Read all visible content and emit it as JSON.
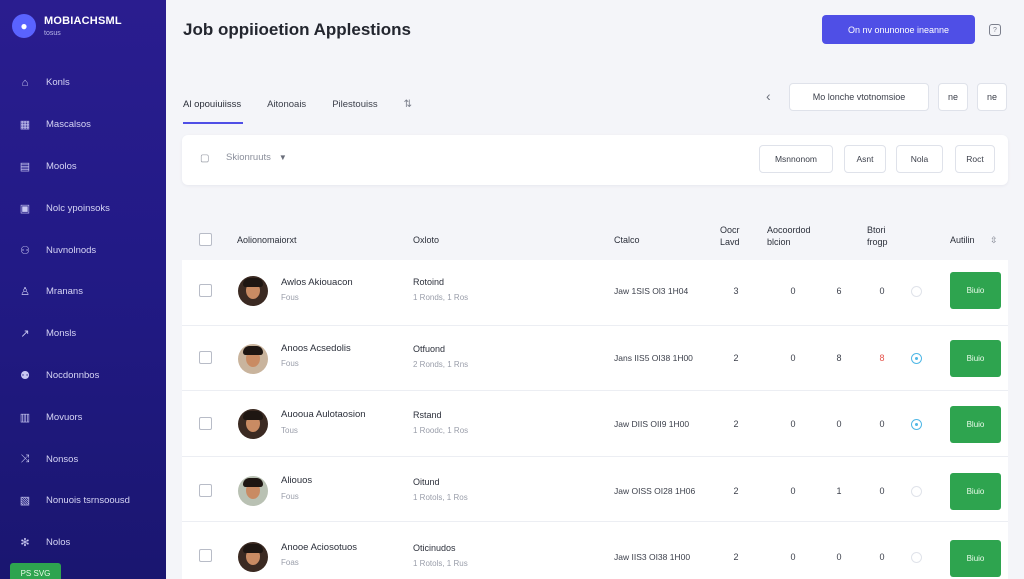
{
  "brand": {
    "title": "MOBIACHSML",
    "subtitle": "tosus",
    "logo_icon": "robot-icon"
  },
  "sidebar": {
    "items": [
      {
        "label": "Konls",
        "icon": "home-icon"
      },
      {
        "label": "Mascalsos",
        "icon": "grid-icon"
      },
      {
        "label": "Moolos",
        "icon": "layers-icon"
      },
      {
        "label": "Nolc ypoinsoks",
        "icon": "briefcase-icon"
      },
      {
        "label": "Nuvnolnods",
        "icon": "users-icon"
      },
      {
        "label": "Mranans",
        "icon": "user-icon"
      },
      {
        "label": "Monsls",
        "icon": "chart-icon"
      },
      {
        "label": "Nocdonnbos",
        "icon": "people-icon"
      },
      {
        "label": "Movuors",
        "icon": "calendar-icon"
      },
      {
        "label": "Nonsos",
        "icon": "share-icon"
      },
      {
        "label": "Nonuois tsrnsoousd",
        "icon": "document-icon"
      },
      {
        "label": "Nolos",
        "icon": "gear-icon"
      }
    ],
    "badge": "PS  SVG"
  },
  "header": {
    "title": "Job oppiioetion Applestions",
    "primary_button": "On nv onunonoe ineanne"
  },
  "tabs": [
    {
      "label": "Al opouiuiisss",
      "active": true
    },
    {
      "label": "Aitonoais",
      "active": false
    },
    {
      "label": "Pilestouiss",
      "active": false
    }
  ],
  "tab_icon": "filter-icon",
  "pager": {
    "search_label": "Mo  lonche vtotnomsioe",
    "btn1": "ne",
    "btn2": "ne"
  },
  "filter": {
    "dropdown_label": "Skionruuts",
    "buttons": [
      "Msnnonom",
      "Asnt",
      "Nola",
      "Roct"
    ]
  },
  "table": {
    "headers": {
      "applicant": "Aolionomaiorxt",
      "status": "Oxloto",
      "date": "Ctalco",
      "col_a": "Oocr\nLavd",
      "col_b": "Aocoordod\nblcion",
      "col_c": "Btori\nfrogp",
      "actions": "Autilin"
    },
    "rows": [
      {
        "name": "Awlos Akiouacon",
        "sub": "Fous",
        "status": "Rotoind",
        "status_sub": "1 Ronds, 1 Ros",
        "date": "Jaw 1SIS  Ol3 1H04",
        "a": "3",
        "b": "0",
        "c": "6",
        "d": "0",
        "d_red": false,
        "dot": false,
        "action": "Biuio"
      },
      {
        "name": "Anoos Acsedolis",
        "sub": "Fous",
        "status": "Otfuond",
        "status_sub": "2 Ronds, 1 Rns",
        "date": "Jans IIS5  OI38 1H00",
        "a": "2",
        "b": "0",
        "c": "8",
        "d": "8",
        "d_red": true,
        "dot": true,
        "action": "Biuio"
      },
      {
        "name": "Auooua Aulotaosion",
        "sub": "Tous",
        "status": "Rstand",
        "status_sub": "1 Roodc, 1 Ros",
        "date": "Jaw DIIS  OII9 1H00",
        "a": "2",
        "b": "0",
        "c": "0",
        "d": "0",
        "d_red": false,
        "dot": true,
        "action": "Bluio"
      },
      {
        "name": "Aliouos",
        "sub": "Fous",
        "status": "Oitund",
        "status_sub": "1 Rotols, 1 Ros",
        "date": "Jaw OISS  OI28 1H06",
        "a": "2",
        "b": "0",
        "c": "1",
        "d": "0",
        "d_red": false,
        "dot": false,
        "action": "Biuio"
      },
      {
        "name": "Anooe Aciosotuos",
        "sub": "Foas",
        "status": "Oticinudos",
        "status_sub": "1 Rotols, 1 Rus",
        "date": "Jaw IIS3  OI38 1H00",
        "a": "2",
        "b": "0",
        "c": "0",
        "d": "0",
        "d_red": false,
        "dot": false,
        "action": "Biuio"
      }
    ]
  }
}
